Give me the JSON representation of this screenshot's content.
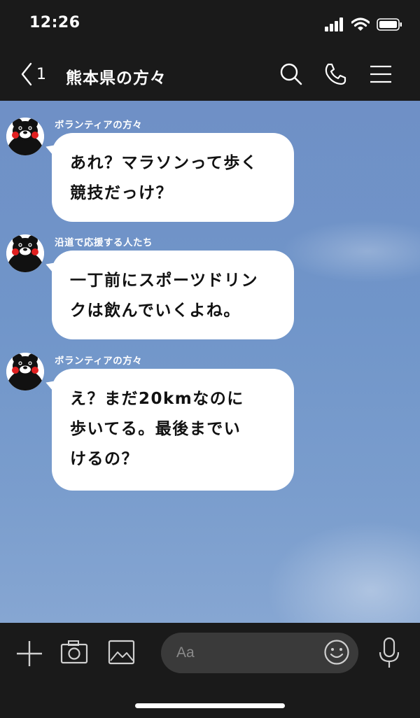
{
  "status": {
    "time": "12:26"
  },
  "header": {
    "back_count": "1",
    "title": "熊本県の方々"
  },
  "messages": [
    {
      "sender": "ボランティアの方々",
      "lines": [
        "あれ？マラソンって歩く",
        "競技だっけ？"
      ]
    },
    {
      "sender": "沿道で応援する人たち",
      "lines": [
        "一丁前にスポーツドリン",
        "クは飲んでいくよね。"
      ]
    },
    {
      "sender": "ボランティアの方々",
      "lines": [
        "え？まだ20kmなのに",
        "歩いてる。最後までい",
        "けるの？"
      ]
    }
  ],
  "input": {
    "placeholder": "Aa"
  },
  "colors": {
    "chat_bg": "#7095c9",
    "bar_bg": "#1a1a1a",
    "bubble": "#ffffff"
  },
  "icons": [
    "signal-icon",
    "wifi-icon",
    "battery-icon",
    "back-chevron-icon",
    "search-icon",
    "phone-icon",
    "menu-icon",
    "plus-icon",
    "camera-icon",
    "image-icon",
    "emoji-icon",
    "microphone-icon",
    "kumamon-avatar"
  ]
}
